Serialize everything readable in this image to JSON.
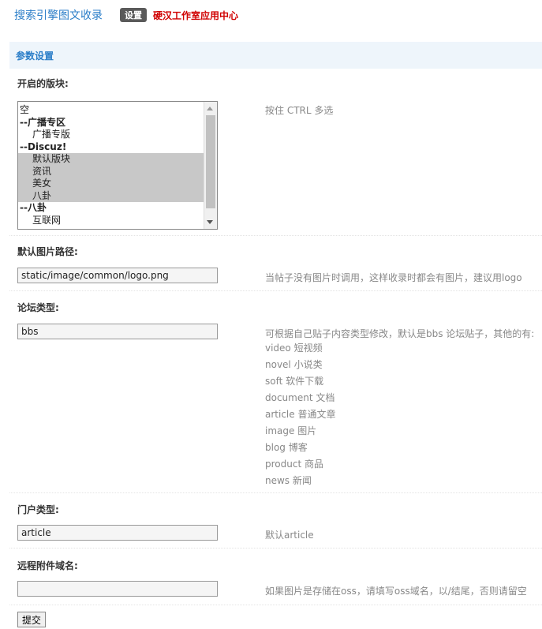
{
  "header": {
    "title": "搜索引擎图文收录",
    "badge": "设置",
    "link": "硬汉工作室应用中心"
  },
  "section": {
    "title": "参数设置"
  },
  "fields": {
    "blocks": {
      "label": "开启的版块:",
      "hint": "按住 CTRL 多选",
      "options": [
        {
          "text": "空",
          "kind": "plain",
          "selected": false
        },
        {
          "text": "--广播专区",
          "kind": "group",
          "selected": false
        },
        {
          "text": "广播专版",
          "kind": "sub",
          "selected": false
        },
        {
          "text": "--Discuz!",
          "kind": "group",
          "selected": false
        },
        {
          "text": "默认版块",
          "kind": "sub",
          "selected": true
        },
        {
          "text": "资讯",
          "kind": "sub",
          "selected": true
        },
        {
          "text": "美女",
          "kind": "sub",
          "selected": true
        },
        {
          "text": "八卦",
          "kind": "sub",
          "selected": true
        },
        {
          "text": "--八卦",
          "kind": "group",
          "selected": false
        },
        {
          "text": "互联网",
          "kind": "sub",
          "selected": false
        }
      ]
    },
    "default_image": {
      "label": "默认图片路径:",
      "value": "static/image/common/logo.png",
      "hint": "当帖子没有图片时调用，这样收录时都会有图片，建议用logo"
    },
    "forum_type": {
      "label": "论坛类型:",
      "value": "bbs",
      "hint": "可根据自己贴子内容类型修改，默认是bbs 论坛贴子，其他的有:",
      "types": [
        "video 短视频",
        "novel 小说类",
        "soft 软件下载",
        "document 文档",
        "article 普通文章",
        "image 图片",
        "blog 博客",
        "product 商品",
        "news 新闻"
      ]
    },
    "portal_type": {
      "label": "门户类型:",
      "value": "article",
      "hint": "默认article"
    },
    "remote_domain": {
      "label": "远程附件域名:",
      "value": "",
      "hint": "如果图片是存储在oss，请填写oss域名，以/结尾，否则请留空"
    }
  },
  "submit_label": "提交"
}
